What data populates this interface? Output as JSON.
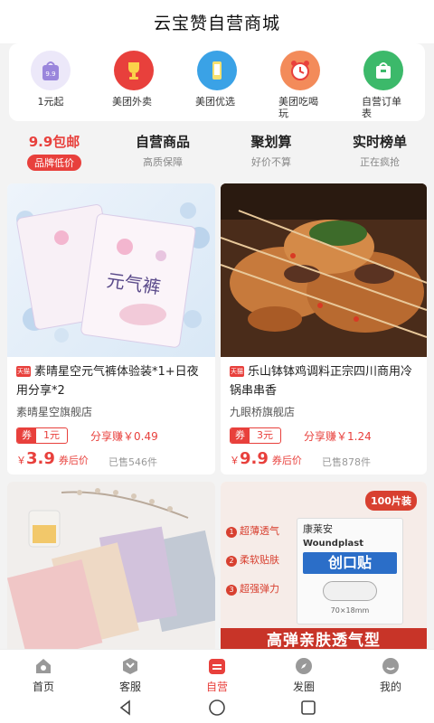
{
  "header": {
    "title": "云宝赞自营商城"
  },
  "categories": [
    {
      "label": "1元起",
      "icon": "nine-nine-bag-icon",
      "color": "#8f7bd6"
    },
    {
      "label": "美团外卖",
      "icon": "trophy-icon",
      "color": "#e8403c"
    },
    {
      "label": "美团优选",
      "icon": "smartphone-icon",
      "color": "#3aa2e6"
    },
    {
      "label": "美团吃喝玩",
      "icon": "alarm-clock-icon",
      "color": "#f07042"
    },
    {
      "label": "自营订单表",
      "icon": "shopping-bag-icon",
      "color": "#3cb96a"
    }
  ],
  "tabs": [
    {
      "title": "9.9包邮",
      "sub": "品牌低价"
    },
    {
      "title": "自营商品",
      "sub": "高质保障"
    },
    {
      "title": "聚划算",
      "sub": "好价不算"
    },
    {
      "title": "实时榜单",
      "sub": "正在疯抢"
    }
  ],
  "products": [
    {
      "badge": "天猫",
      "name": "素晴星空元气裤体验装*1+日夜用分享*2",
      "shop": "素晴星空旗舰店",
      "coupon_label": "券",
      "coupon_value": "1元",
      "share": "分享赚￥0.49",
      "currency": "￥",
      "price": "3.9",
      "after_coupon": "券后价",
      "sold": "已售546件",
      "image_text": "元气裤"
    },
    {
      "badge": "天猫",
      "name": "乐山钵钵鸡调料正宗四川商用冷锅串串香",
      "shop": "九眼桥旗舰店",
      "coupon_label": "券",
      "coupon_value": "3元",
      "share": "分享赚￥1.24",
      "currency": "￥",
      "price": "9.9",
      "after_coupon": "券后价",
      "sold": "已售878件"
    }
  ],
  "product3": {},
  "product4": {
    "count_badge": "100片装",
    "brand": "康莱安",
    "en": "Woundplast",
    "title": "创口贴",
    "size": "70×18mm",
    "features": [
      "超薄透气",
      "柔软贴肤",
      "超强弹力"
    ],
    "bottom_banner": "高弹亲肤透气型"
  },
  "nav": [
    {
      "label": "首页",
      "icon": "home-icon"
    },
    {
      "label": "客服",
      "icon": "customer-service-icon"
    },
    {
      "label": "自营",
      "icon": "store-icon",
      "active": true
    },
    {
      "label": "发圈",
      "icon": "compass-icon"
    },
    {
      "label": "我的",
      "icon": "profile-icon"
    }
  ],
  "colors": {
    "accent": "#e8403c",
    "background": "#f3f3f3"
  }
}
